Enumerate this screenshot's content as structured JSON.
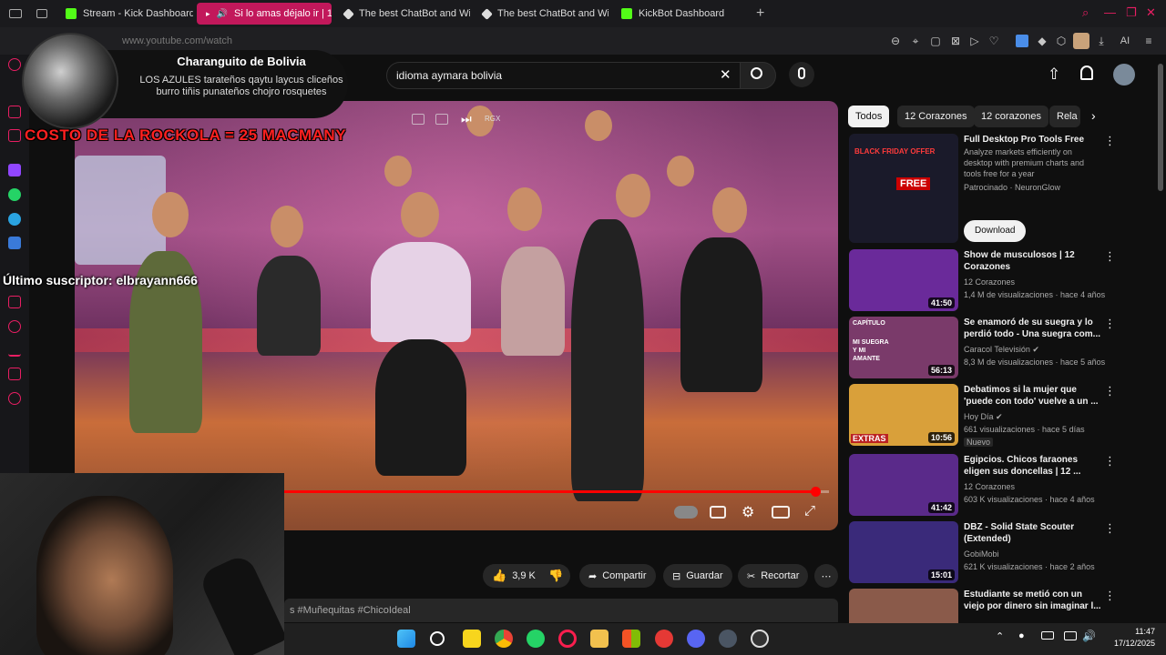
{
  "browser": {
    "tabs": [
      {
        "label": "Stream - Kick Dashboard",
        "color": "#53fc18"
      },
      {
        "label": "Si lo amas déjalo ir | 1",
        "color": "#ffffff",
        "active": true
      },
      {
        "label": "The best ChatBot and Wi",
        "color": "#ffffff"
      },
      {
        "label": "The best ChatBot and Wi",
        "color": "#ffffff"
      },
      {
        "label": "KickBot Dashboard",
        "color": "#53fc18"
      }
    ],
    "new_tab": "+",
    "url": "www.youtube.com/watch",
    "ai_label": "AI"
  },
  "youtube": {
    "search_value": "idioma aymara bolivia",
    "video": {
      "rgx_label": "RGX",
      "progress": 0.975,
      "likes": "3,9 K",
      "share_label": "Compartir",
      "save_label": "Guardar",
      "clip_label": "Recortar",
      "description_snippet": "s #Muñequitas #ChicoIdeal"
    },
    "chips": [
      "Todos",
      "12 Corazones",
      "12 corazones",
      "Rela"
    ],
    "recommendations": [
      {
        "title": "Full Desktop Pro Tools Free",
        "channel": "Analyze markets efficiently on desktop with premium charts and tools free for a year",
        "meta": "Patrocinado · NeuronGlow",
        "button": "Download",
        "thumb_text": "BLACK FRIDAY OFFER",
        "thumb_sub": "FREE",
        "thumb_color": "#1a1a2a"
      },
      {
        "title": "Show de musculosos | 12 Corazones",
        "channel": "12 Corazones",
        "meta": "1,4 M de visualizaciones · hace 4 años",
        "duration": "41:50",
        "thumb_color": "#6a2a9a"
      },
      {
        "title": "Se enamoró de su suegra y lo perdió todo - Una suegra com...",
        "channel": "Caracol Televisión ✔",
        "meta": "8,3 M de visualizaciones · hace 5 años",
        "duration": "56:13",
        "thumb_color": "#7a3a6a",
        "thumb_text": "MI SUEGRA Y MI AMANTE",
        "thumb_sub": "CAPÍTULO"
      },
      {
        "title": "Debatimos si la mujer que 'puede con todo' vuelve a un ...",
        "channel": "Hoy Día ✔",
        "meta": "661 visualizaciones · hace 5 días",
        "badge": "Nuevo",
        "duration": "10:56",
        "thumb_color": "#d9a03a",
        "thumb_text": "EXTRAS"
      },
      {
        "title": "Egipcios. Chicos faraones eligen sus doncellas | 12 ...",
        "channel": "12 Corazones",
        "meta": "603 K visualizaciones · hace 4 años",
        "duration": "41:42",
        "thumb_color": "#5a2a8a"
      },
      {
        "title": "DBZ - Solid State Scouter (Extended)",
        "channel": "GobiMobi",
        "meta": "621 K visualizaciones · hace 2 años",
        "duration": "15:01",
        "thumb_color": "#3a2a7a"
      },
      {
        "title": "Estudiante se metió con un viejo por dinero sin imaginar l...",
        "channel": "",
        "meta": "",
        "thumb_color": "#8a5a4a"
      }
    ]
  },
  "overlay": {
    "chat_user": "Charanguito de Bolivia",
    "chat_message": "LOS AZULES tarateños qaytu laycus cliceños burro tiñis punateños chojro rosquetes",
    "rockola": "COSTO DE LA ROCKOLA = 25 MACMANY",
    "subscriber": "Último suscriptor: elbrayann666"
  },
  "taskbar": {
    "time": "11:47",
    "date": "17/12/2025"
  },
  "colors": {
    "accent": "#e91e63",
    "yt_red": "#ff0000",
    "kick_green": "#53fc18"
  }
}
